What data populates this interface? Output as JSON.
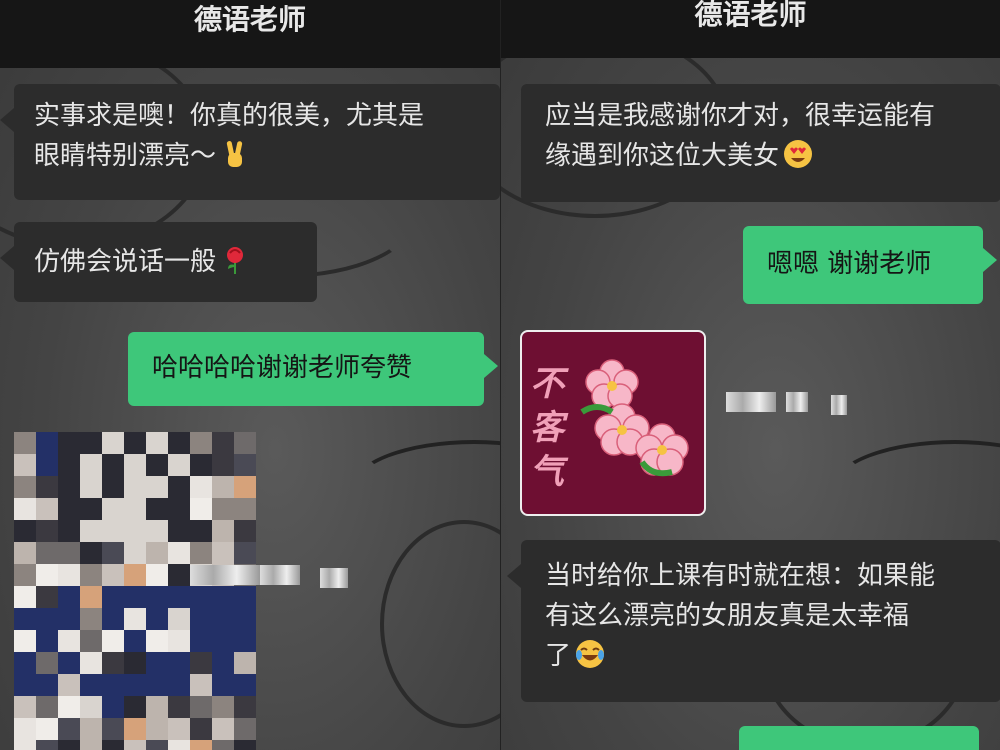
{
  "left": {
    "title": "德语老师",
    "messages": [
      {
        "line1": "实事求是噢！你真的很美，尤其是",
        "line2": "眼睛特别漂亮～",
        "emoji": "victory-hand"
      },
      {
        "text": "仿佛会说话一般",
        "emoji": "rose"
      },
      {
        "text": "哈哈哈哈谢谢老师夸赞"
      }
    ]
  },
  "right": {
    "title": "德语老师",
    "messages": [
      {
        "line1": "应当是我感谢你才对，很幸运能有",
        "line2": "缘遇到你这位大美女",
        "emoji": "heart-eyes-face"
      },
      {
        "text": "嗯嗯 谢谢老师"
      },
      {
        "sticker_text": "不客气"
      },
      {
        "line1": "当时给你上课有时就在想：如果能",
        "line2": "有这么漂亮的女朋友真是太幸福",
        "line3": "了",
        "emoji": "crying-laughing-face"
      }
    ]
  },
  "colors": {
    "sent": "#3ec77a",
    "received": "#2c2c2c",
    "topbar": "#161616"
  }
}
